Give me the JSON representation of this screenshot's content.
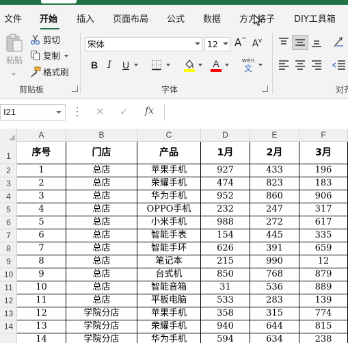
{
  "ribbon_tabs": [
    "文件",
    "开始",
    "插入",
    "页面布局",
    "公式",
    "数据",
    "方方格子",
    "DIY工具箱"
  ],
  "clipboard": {
    "paste": "粘贴",
    "cut": "剪切",
    "copy": "复制",
    "format_painter": "格式刷",
    "group_label": "剪贴板"
  },
  "font": {
    "name": "宋体",
    "size": "12",
    "bold": "B",
    "italic": "I",
    "underline": "U",
    "phonetic": "wén",
    "group_label": "字体",
    "fill_color": "#ffff00",
    "font_color": "#ff0000"
  },
  "alignment": {
    "group_label": "对齐"
  },
  "formula_bar": {
    "name_box": "I21",
    "fx": "fx",
    "value": ""
  },
  "grid": {
    "columns": [
      "A",
      "B",
      "C",
      "D",
      "E",
      "F"
    ],
    "row_numbers": [
      "1",
      "2",
      "3",
      "4",
      "5",
      "6",
      "7",
      "8",
      "9",
      "10",
      "11",
      "12",
      "13",
      "14"
    ],
    "header": [
      "序号",
      "门店",
      "产品",
      "1月",
      "2月",
      "3月"
    ],
    "rows": [
      [
        "1",
        "总店",
        "苹果手机",
        "927",
        "433",
        "196"
      ],
      [
        "2",
        "总店",
        "荣耀手机",
        "474",
        "823",
        "183"
      ],
      [
        "3",
        "总店",
        "华为手机",
        "952",
        "860",
        "906"
      ],
      [
        "4",
        "总店",
        "OPPO手机",
        "232",
        "247",
        "317"
      ],
      [
        "5",
        "总店",
        "小米手机",
        "988",
        "272",
        "617"
      ],
      [
        "6",
        "总店",
        "智能手表",
        "154",
        "445",
        "335"
      ],
      [
        "7",
        "总店",
        "智能手环",
        "626",
        "391",
        "659"
      ],
      [
        "8",
        "总店",
        "笔记本",
        "215",
        "990",
        "12"
      ],
      [
        "9",
        "总店",
        "台式机",
        "850",
        "768",
        "879"
      ],
      [
        "10",
        "总店",
        "智能音箱",
        "31",
        "536",
        "889"
      ],
      [
        "11",
        "总店",
        "平板电脑",
        "533",
        "283",
        "139"
      ],
      [
        "12",
        "学院分店",
        "苹果手机",
        "358",
        "315",
        "774"
      ],
      [
        "13",
        "学院分店",
        "荣耀手机",
        "940",
        "644",
        "815"
      ],
      [
        "14",
        "学院分店",
        "华为手机",
        "594",
        "634",
        "238"
      ]
    ]
  }
}
